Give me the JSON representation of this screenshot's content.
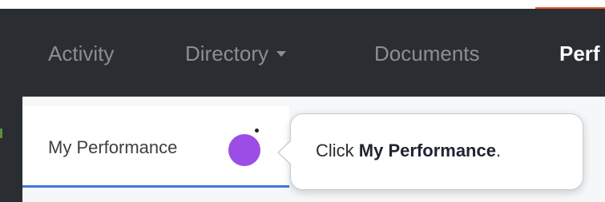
{
  "nav": {
    "items": [
      {
        "label": "Activity"
      },
      {
        "label": "Directory"
      },
      {
        "label": "Documents"
      },
      {
        "label": "Perf"
      }
    ]
  },
  "subnav": {
    "active_tab_label": "My Performance"
  },
  "tooltip": {
    "prefix": "Click ",
    "target": "My Performance",
    "suffix": "."
  },
  "colors": {
    "navbar_bg": "#2a2d31",
    "tab_underline": "#3f78d8",
    "cursor_dot": "#9b4de6",
    "accent_line": "#e8572a"
  }
}
